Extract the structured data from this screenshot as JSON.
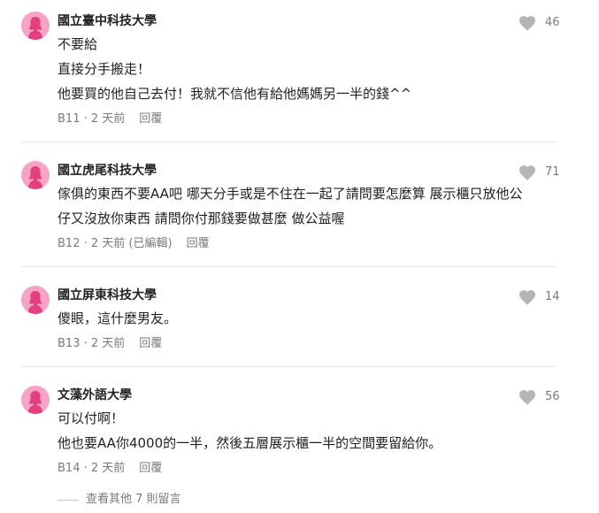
{
  "comments": [
    {
      "school": "國立臺中科技大學",
      "likes": "46",
      "lines": [
        "不要給",
        "直接分手搬走！",
        "他要買的他自己去付！我就不信他有給他媽媽另一半的錢^^"
      ],
      "floor": "B11",
      "time": "2 天前",
      "edited": "",
      "reply": "回覆"
    },
    {
      "school": "國立虎尾科技大學",
      "likes": "71",
      "lines": [
        "傢俱的東西不要AA吧 哪天分手或是不住在一起了請問要怎麼算 展示櫃只放他公",
        "仔又沒放你東西 請問你付那錢要做甚麼 做公益喔"
      ],
      "floor": "B12",
      "time": "2 天前",
      "edited": "(已編輯)",
      "reply": "回覆"
    },
    {
      "school": "國立屏東科技大學",
      "likes": "14",
      "lines": [
        "傻眼，這什麼男友。"
      ],
      "floor": "B13",
      "time": "2 天前",
      "edited": "",
      "reply": "回覆"
    },
    {
      "school": "文藻外語大學",
      "likes": "56",
      "lines": [
        "可以付啊！",
        "他也要AA你4000的一半，然後五層展示櫃一半的空間要留給你。"
      ],
      "floor": "B14",
      "time": "2 天前",
      "edited": "",
      "reply": "回覆"
    }
  ],
  "more_comments": "查看其他 7 則留言",
  "colors": {
    "avatar_bg": "#f6a3c5",
    "avatar_figure": "#e3407f",
    "heart": "#b5b5b5",
    "meta_text": "#7a7a7a"
  },
  "icons": {
    "avatar": "female-avatar-icon",
    "like": "heart-icon"
  }
}
